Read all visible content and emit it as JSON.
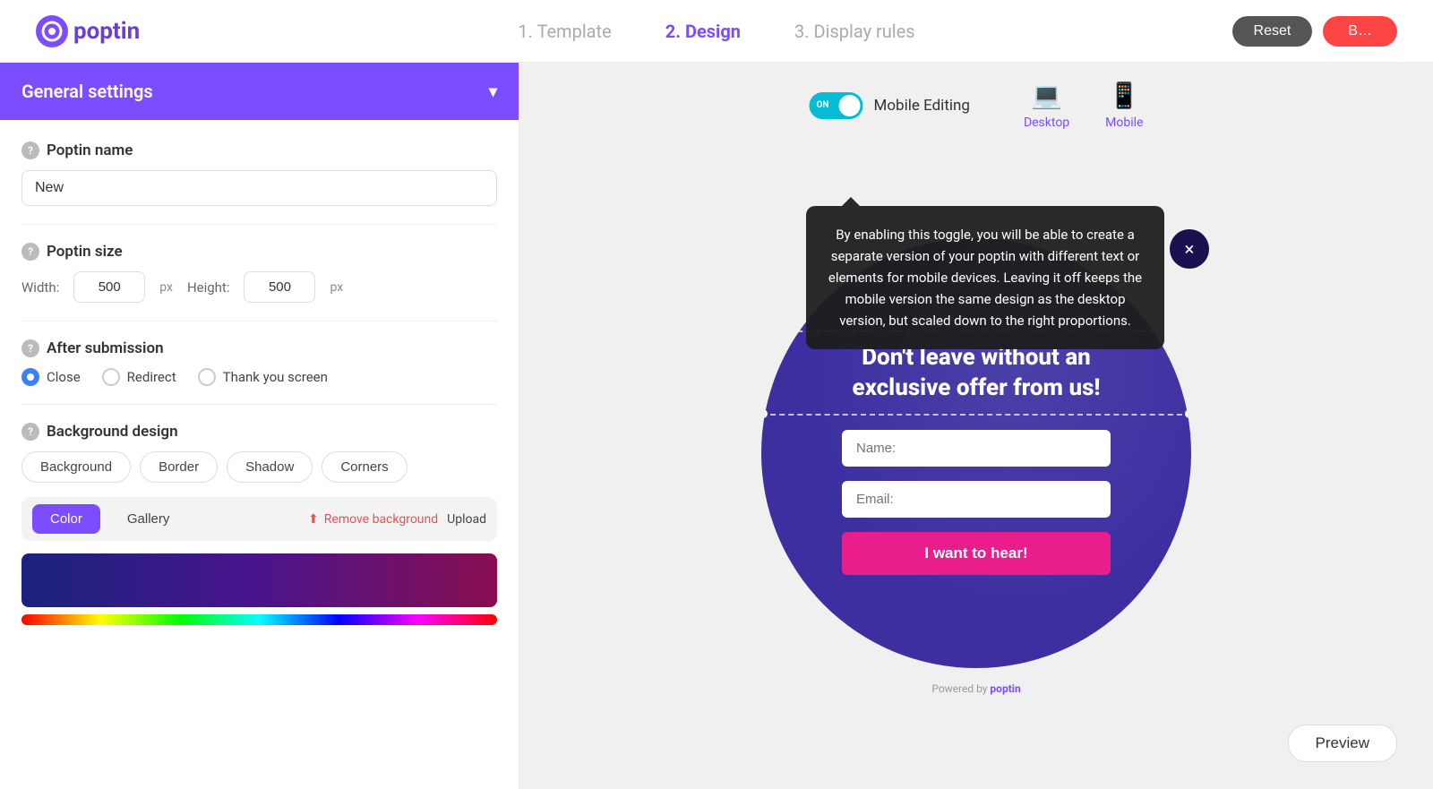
{
  "header": {
    "logo_text": "poptin",
    "steps": [
      {
        "id": "template",
        "label": "1. Template",
        "active": false
      },
      {
        "id": "design",
        "label": "2. Design",
        "active": true
      },
      {
        "id": "display_rules",
        "label": "3. Display rules",
        "active": false
      }
    ],
    "reset_label": "Reset",
    "save_label": "B…"
  },
  "sidebar": {
    "section_title": "General settings",
    "poptin_name": {
      "label": "Poptin name",
      "value": "New"
    },
    "poptin_size": {
      "label": "Poptin size",
      "width_label": "Width:",
      "width_value": "500",
      "height_label": "Height:",
      "height_value": "500",
      "px": "px"
    },
    "after_submission": {
      "label": "After submission",
      "options": [
        {
          "id": "close",
          "label": "Close",
          "selected": true
        },
        {
          "id": "redirect",
          "label": "Redirect",
          "selected": false
        },
        {
          "id": "thank_you",
          "label": "Thank you screen",
          "selected": false
        }
      ]
    },
    "background_design": {
      "label": "Background design",
      "tabs": [
        "Background",
        "Border",
        "Shadow",
        "Corners"
      ]
    },
    "color_section": {
      "color_label": "Color",
      "gallery_label": "Gallery",
      "remove_label": "Remove background",
      "upload_label": "Upload"
    }
  },
  "preview": {
    "toggle_on_label": "ON",
    "mobile_editing_label": "Mobile Editing",
    "desktop_label": "Desktop",
    "mobile_label": "Mobile",
    "popup": {
      "headline": "Don't leave without an exclusive offer from us!",
      "name_placeholder": "Name:",
      "email_placeholder": "Email:",
      "submit_label": "I want to hear!",
      "close_symbol": "×",
      "powered_by": "Powered by poptin"
    },
    "preview_btn_label": "Preview"
  },
  "tooltip": {
    "text": "By enabling this toggle, you will be able to create a separate version of your poptin with different text or elements for mobile devices. Leaving it off keeps the mobile version the same design as the desktop version, but scaled down to the right proportions."
  }
}
